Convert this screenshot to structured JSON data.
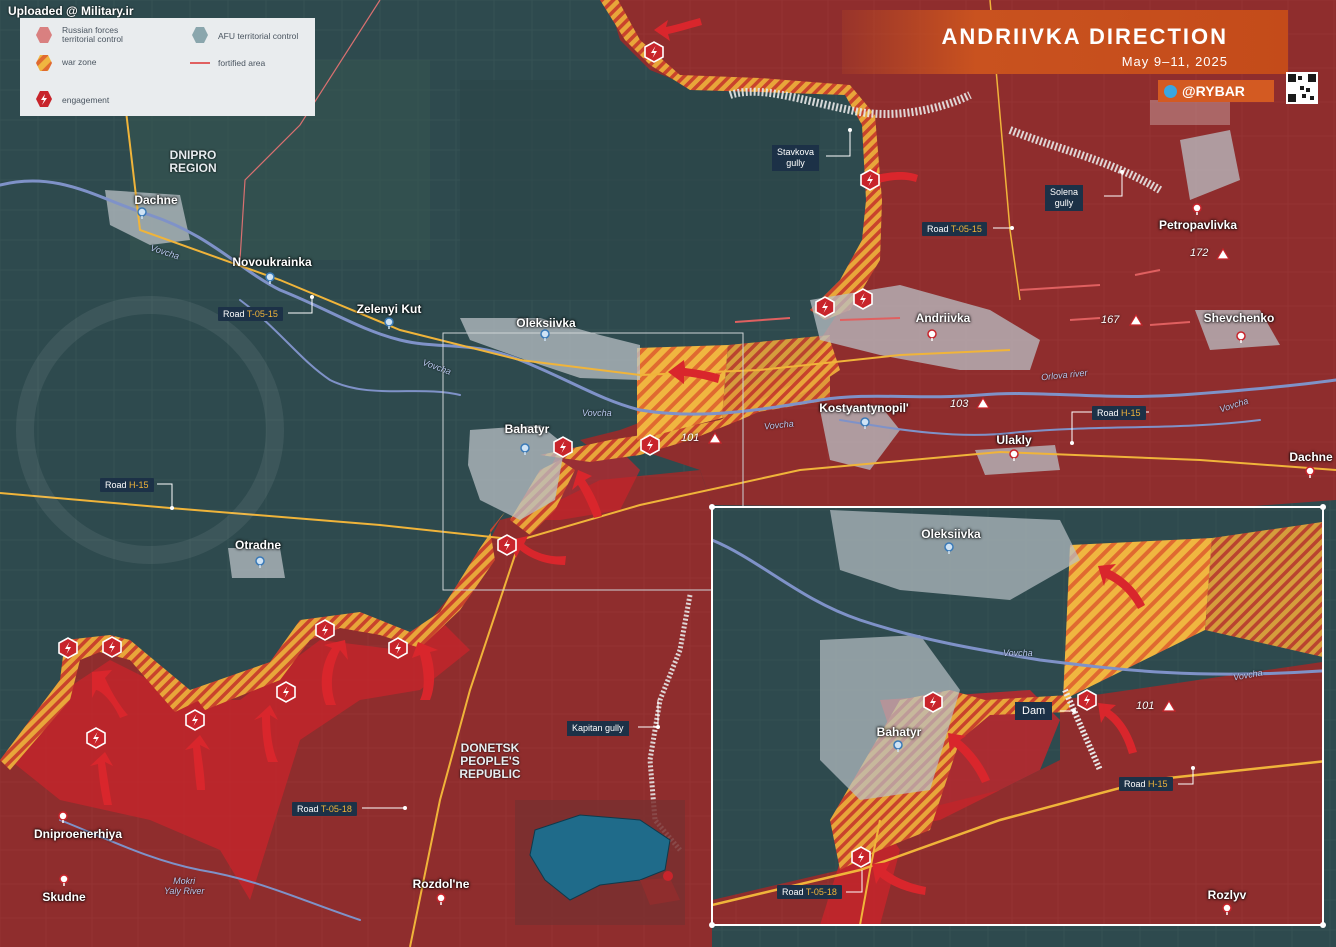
{
  "watermark": "Uploaded @ Military.ir",
  "header": {
    "title": "ANDRIIVKA DIRECTION",
    "date": "May 9–11, 2025",
    "brand": "@RYBAR"
  },
  "legend": {
    "russian": "Russian forces\nterritorial control",
    "afu": "AFU territorial control",
    "war_zone": "war zone",
    "fortified": "fortified area",
    "engagement": "engagement"
  },
  "colors": {
    "russian": "#8f2d2d",
    "afu": "#2e4a4e",
    "war_zone": "#e0a040",
    "engagement": "#c8242b",
    "road": "#f0b43a",
    "river": "#7f92c8"
  },
  "regions": {
    "dnipro": "DNIPRO\nREGION",
    "donetsk": "DONETSK\nPEOPLE'S\nREPUBLIC"
  },
  "towns": {
    "dachne_w": "Dachne",
    "novoukrainka": "Novoukrainka",
    "zelenyi_kut": "Zelenyi Kut",
    "oleksiivka": "Oleksiivka",
    "bahatyr": "Bahatyr",
    "otradne": "Otradne",
    "andriivka": "Andriivka",
    "kostyantynopil": "Kostyantynopil'",
    "ulakly": "Ulakly",
    "dachne_e": "Dachne",
    "petropavlivka": "Petropavlivka",
    "shevchenko": "Shevchenko",
    "dniproenerhiya": "Dniproenerhiya",
    "skudne": "Skudne",
    "rozdolne": "Rozdol'ne",
    "rozlyv": "Rozlyv"
  },
  "rivers": {
    "vovcha_1": "Vovcha",
    "vovcha_2": "Vovcha",
    "vovcha_3": "Vovcha",
    "vovcha_4": "Vovcha",
    "vovcha_5": "Vovcha",
    "orlova": "Orlova river",
    "mokri_yaly": "Mokri\nYaly River"
  },
  "roads": {
    "prefix": "Road",
    "t0515_a": "T-05-15",
    "t0515_b": "T-05-15",
    "h15_a": "H-15",
    "h15_b": "H-15",
    "h15_c": "H-15",
    "t0518_a": "T-05-18",
    "t0518_b": "T-05-18"
  },
  "callouts": {
    "stavkova": "Stavkova\ngully",
    "solena": "Solena\ngully",
    "kapitan": "Kapitan gully",
    "dam": "Dam"
  },
  "heights": {
    "h172": "172",
    "h167": "167",
    "h103": "103",
    "h101": "101",
    "h101_inset": "101"
  }
}
